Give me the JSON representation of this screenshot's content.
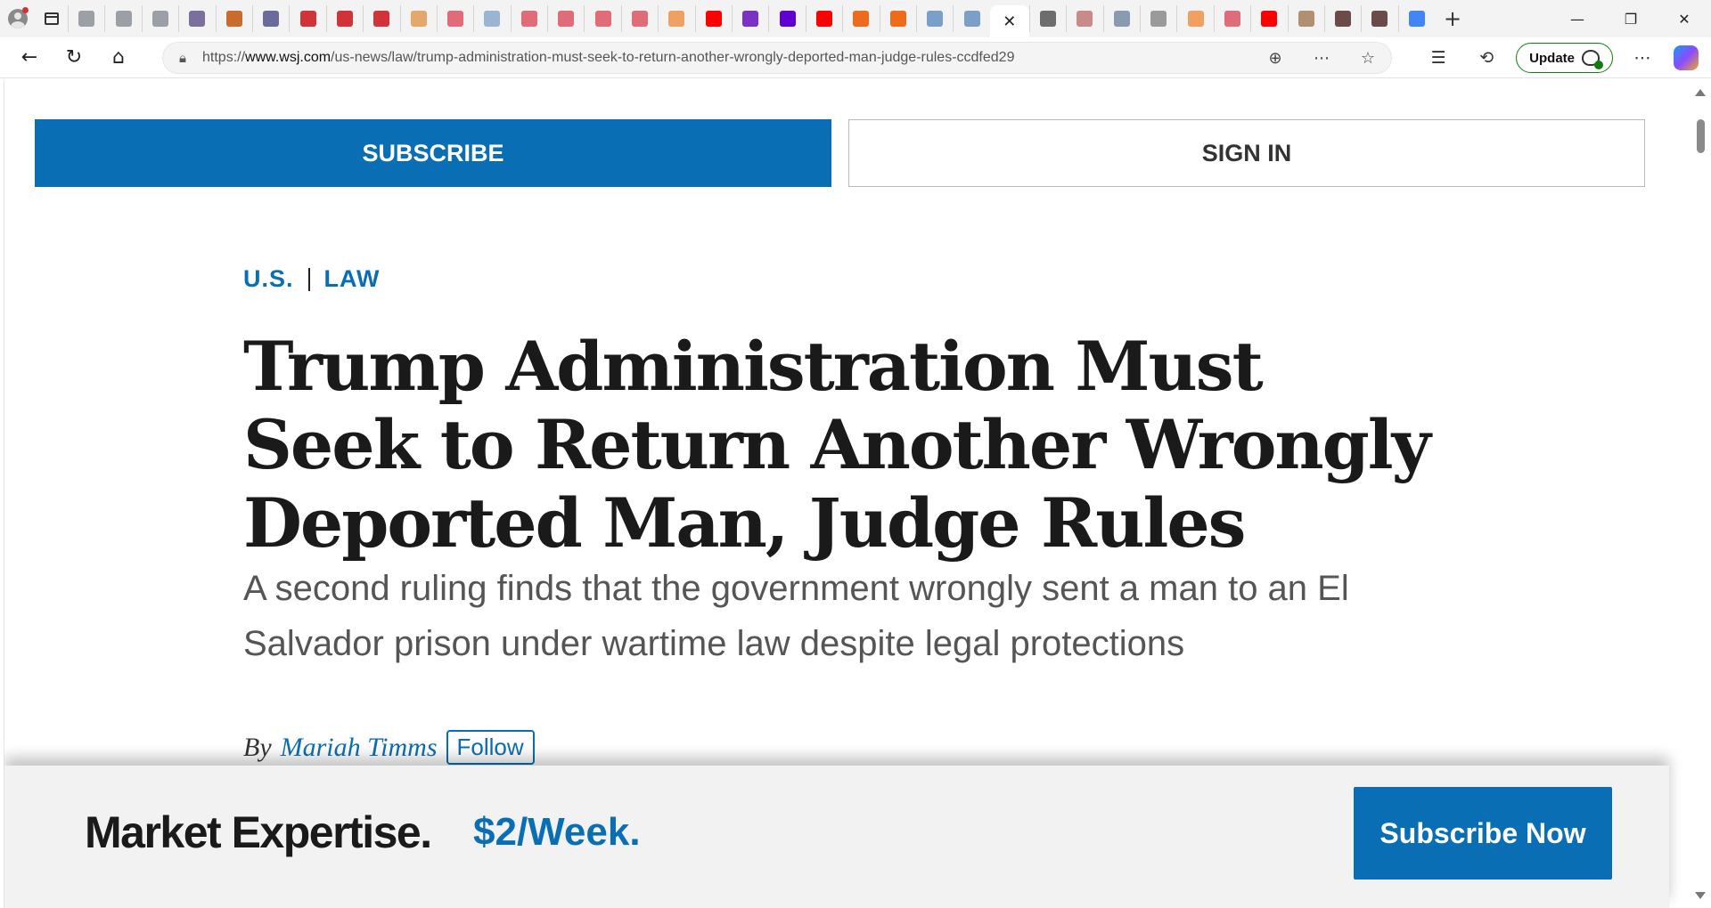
{
  "browser": {
    "tabs": [
      {
        "icon": "globe-icon",
        "color": "#9aa0a6"
      },
      {
        "icon": "globe-icon",
        "color": "#9aa0a6"
      },
      {
        "icon": "globe-icon",
        "color": "#9aa0a6"
      },
      {
        "icon": "news-icon",
        "color": "#7b6f9b"
      },
      {
        "icon": "book-icon",
        "color": "#c96b2c"
      },
      {
        "icon": "arrow-icon",
        "color": "#6b6b9b"
      },
      {
        "icon": "r-icon",
        "color": "#d13438"
      },
      {
        "icon": "r-icon",
        "color": "#d13438"
      },
      {
        "icon": "pdf-icon",
        "color": "#d13438"
      },
      {
        "icon": "circle-icon",
        "color": "#e3a86a"
      },
      {
        "icon": "play-icon",
        "color": "#e06b79"
      },
      {
        "icon": "w-icon",
        "color": "#9bb4d4"
      },
      {
        "icon": "play-icon",
        "color": "#e06b79"
      },
      {
        "icon": "play-icon",
        "color": "#e06b79"
      },
      {
        "icon": "pdf-icon",
        "color": "#e06b79"
      },
      {
        "icon": "play-icon",
        "color": "#e06b79"
      },
      {
        "icon": "b-icon",
        "color": "#f0a060"
      },
      {
        "icon": "youtube-icon",
        "color": "#ff0000"
      },
      {
        "icon": "yahoo-icon",
        "color": "#7b32c4"
      },
      {
        "icon": "yahoo-icon",
        "color": "#5f01d1"
      },
      {
        "icon": "youtube-icon",
        "color": "#ff0000"
      },
      {
        "icon": "bookmark-icon",
        "color": "#f06a1c"
      },
      {
        "icon": "bookmark-icon",
        "color": "#f06a1c"
      },
      {
        "icon": "search-icon",
        "color": "#7aa0c8"
      },
      {
        "icon": "search-icon",
        "color": "#7aa0c8"
      }
    ],
    "tabs_after": [
      {
        "icon": "s-icon",
        "color": "#6d6d6d"
      },
      {
        "icon": "bird-icon",
        "color": "#c98a8a"
      },
      {
        "icon": "gp-icon",
        "color": "#8a9bb0"
      },
      {
        "icon": "chart-icon",
        "color": "#9a9a9a"
      },
      {
        "icon": "b-icon",
        "color": "#f0a060"
      },
      {
        "icon": "play-icon",
        "color": "#e06b79"
      },
      {
        "icon": "youtube-icon",
        "color": "#ff0000"
      },
      {
        "icon": "photo-icon",
        "color": "#b09070"
      },
      {
        "icon": "rs-icon",
        "color": "#6b4a4a"
      },
      {
        "icon": "rs-icon",
        "color": "#6b4a4a"
      },
      {
        "icon": "g-icon",
        "color": "#4285f4"
      }
    ],
    "url_prefix": "https://",
    "url_host": "www.wsj.com",
    "url_path": "/us-news/law/trump-administration-must-seek-to-return-another-wrongly-deported-man-judge-rules-ccdfed29",
    "update_label": "Update"
  },
  "page": {
    "subscribe_label": "SUBSCRIBE",
    "signin_label": "SIGN IN",
    "crumb_section": "U.S.",
    "crumb_subsection": "LAW",
    "headline": "Trump Administration Must Seek to Return Another Wrongly Deported Man, Judge Rules",
    "dek": "A second ruling finds that the government wrongly sent a man to an El Salvador prison under wartime law despite legal protections",
    "by": "By",
    "author": "Mariah Timms",
    "follow_label": "Follow"
  },
  "promo": {
    "headline": "Market Expertise.",
    "price": "$2/Week.",
    "cta": "Subscribe Now"
  },
  "colors": {
    "brand_blue": "#0a6eb4"
  }
}
